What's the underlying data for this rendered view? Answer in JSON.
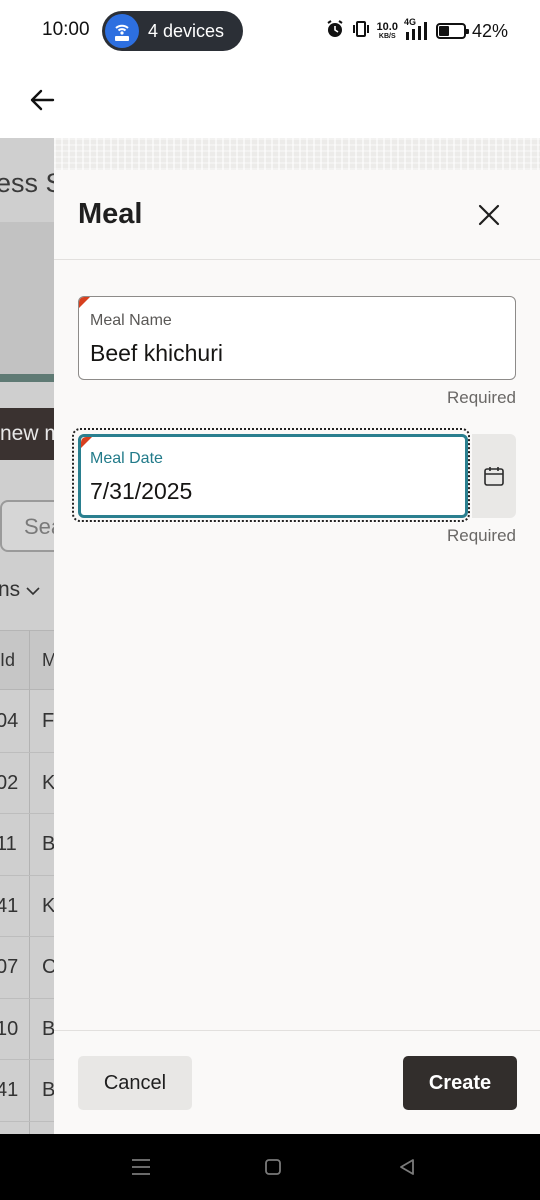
{
  "status_bar": {
    "time": "10:00",
    "hotspot_label": "4 devices",
    "net_speed_value": "10.0",
    "net_speed_unit": "KB/S",
    "network_type": "4G",
    "battery_percent": "42%",
    "battery_level": 0.42
  },
  "background_page": {
    "title": "ess S",
    "new_button": "new m",
    "search_placeholder": "Sea",
    "columns_toggle": "ns",
    "table_header": [
      "Id",
      "M"
    ],
    "rows": [
      [
        "04",
        "F"
      ],
      [
        "02",
        "K"
      ],
      [
        "11",
        "B"
      ],
      [
        "41",
        "K"
      ],
      [
        "07",
        "C"
      ],
      [
        "10",
        "B"
      ],
      [
        "41",
        "B"
      ]
    ]
  },
  "drawer": {
    "title": "Meal",
    "fields": [
      {
        "label": "Meal Name",
        "value": "Beef khichuri",
        "helper": "Required"
      },
      {
        "label": "Meal Date",
        "value": "7/31/2025",
        "helper": "Required"
      }
    ],
    "cancel_label": "Cancel",
    "create_label": "Create"
  },
  "colors": {
    "accent_teal": "#2a7f8f",
    "required_marker": "#d7401f",
    "primary_button": "#322e2c"
  }
}
